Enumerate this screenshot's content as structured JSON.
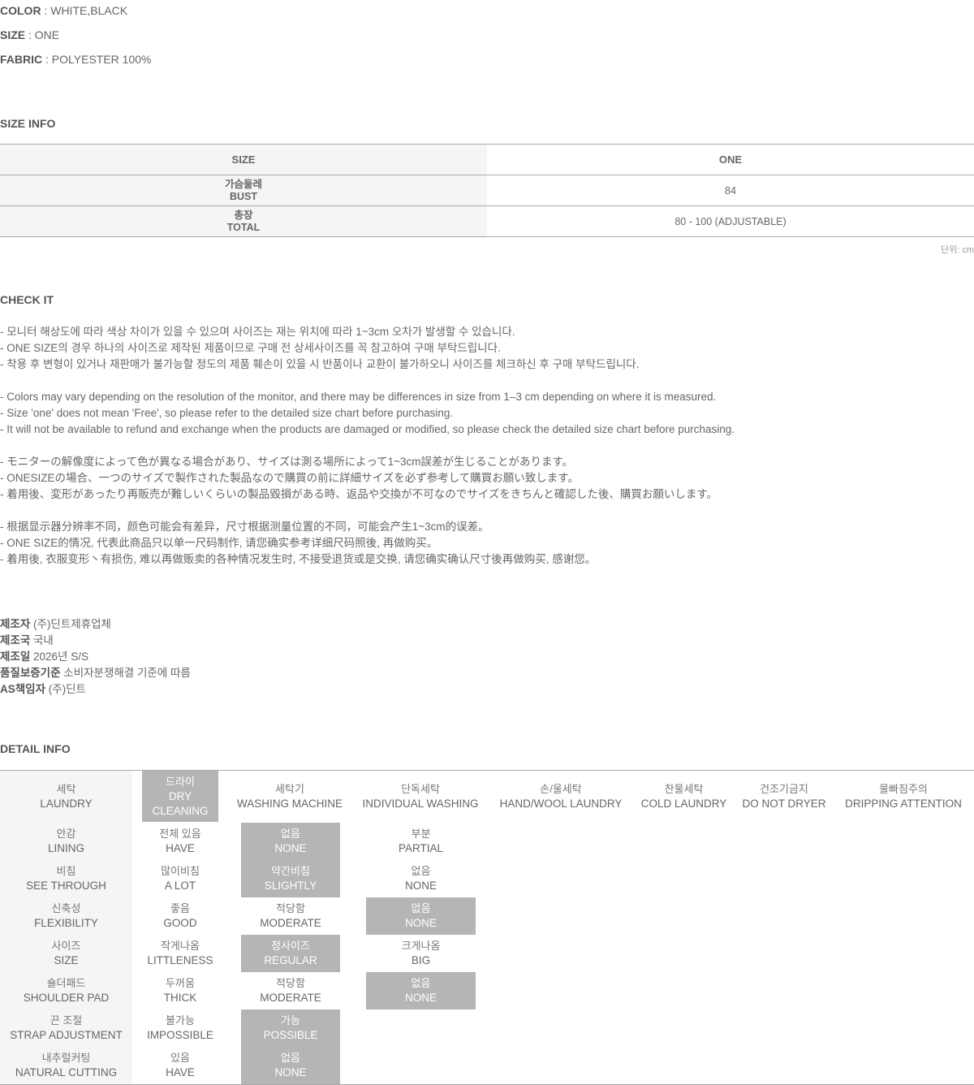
{
  "specs": [
    {
      "key": "COLOR",
      "value": " : WHITE,BLACK"
    },
    {
      "key": "SIZE",
      "value": " : ONE"
    },
    {
      "key": "FABRIC",
      "value": " : POLYESTER 100%"
    }
  ],
  "size_info": {
    "title": "SIZE INFO",
    "header": {
      "label": "SIZE",
      "value": "ONE"
    },
    "rows": [
      {
        "ko": "가슴둘레",
        "en": "BUST",
        "value": "84"
      },
      {
        "ko": "총장",
        "en": "TOTAL",
        "value": "80 - 100 (ADJUSTABLE)"
      }
    ],
    "unit": "단위: cm"
  },
  "check_it": {
    "title": "CHECK IT",
    "lines": [
      "- 모니터 해상도에 따라 색상 차이가 있을 수 있으며 사이즈는 재는 위치에 따라 1~3cm 오차가 발생할 수 있습니다.",
      "- ONE SIZE의 경우 하나의 사이즈로 제작된 제품이므로 구매 전 상세사이즈를 꼭 참고하여 구매 부탁드립니다.",
      "- 착용 후 변형이 있거나 재판매가 불가능할 정도의 제품 훼손이 있을 시 반품이나 교환이 불가하오니 사이즈를 체크하신 후 구매 부탁드립니다.",
      "- Colors may vary depending on the resolution of the monitor, and there may be differences in size from 1–3 cm depending on where it is measured.",
      "- Size 'one' does not mean 'Free', so please refer to the detailed size chart before purchasing.",
      "- It will not be available to refund and exchange when the products are damaged or modified, so please check the detailed size chart before purchasing.",
      "- モニターの解像度によって色が異なる場合があり、サイズは測る場所によって1~3cm誤差が生じることがあります。",
      "- ONESIZEの場合、一つのサイズで製作された製品なので購買の前に詳細サイズを必ず参考して購買お願い致します。",
      "- 着用後、変形があったり再販売が難しいくらいの製品毀損がある時、返品や交換が不可なのでサイズをきちんと確認した後、購買お願いします。",
      "- 根据显示器分辨率不同，颜色可能会有差异，尺寸根据测量位置的不同，可能会产生1~3cm的误差。",
      "- ONE SIZE的情况, 代表此商品只以单一尺码制作, 请您确实参考详细尺码照後, 再做购买。",
      "- 着用後, 衣服变形丶有损伤, 难以再做贩卖的各种情况发生时, 不接受退货或是交换, 请您确实确认尺寸後再做购买, 感谢您。"
    ]
  },
  "manufacturer": [
    {
      "key": "제조자",
      "value": " (주)딘트제휴업체"
    },
    {
      "key": "제조국",
      "value": " 국내"
    },
    {
      "key": "제조일",
      "value": " 2026년 S/S"
    },
    {
      "key": "품질보증기준",
      "value": " 소비자분쟁해결 기준에 따름"
    },
    {
      "key": "AS책임자",
      "value": " (주)딘트"
    }
  ],
  "detail_info": {
    "title": "DETAIL INFO",
    "laundry": {
      "label": {
        "ko": "세탁",
        "en": "LAUNDRY"
      },
      "options": [
        {
          "ko": "드라이",
          "en": "DRY CLEANING",
          "selected": true
        },
        {
          "ko": "세탁기",
          "en": "WASHING MACHINE",
          "selected": false
        },
        {
          "ko": "단독세탁",
          "en": "INDIVIDUAL WASHING",
          "selected": false
        },
        {
          "ko": "손/울세탁",
          "en": "HAND/WOOL LAUNDRY",
          "selected": false
        },
        {
          "ko": "찬물세탁",
          "en": "COLD LAUNDRY",
          "selected": false
        },
        {
          "ko": "건조기금지",
          "en": "DO NOT DRYER",
          "selected": false
        },
        {
          "ko": "물빠짐주의",
          "en": "DRIPPING ATTENTION",
          "selected": false
        }
      ]
    },
    "rows": [
      {
        "label": {
          "ko": "안감",
          "en": "LINING"
        },
        "options": [
          {
            "ko": "전체 있음",
            "en": "HAVE",
            "selected": false
          },
          {
            "ko": "없음",
            "en": "NONE",
            "selected": true
          },
          {
            "ko": "부분",
            "en": "PARTIAL",
            "selected": false
          }
        ]
      },
      {
        "label": {
          "ko": "비침",
          "en": "SEE THROUGH"
        },
        "options": [
          {
            "ko": "많이비침",
            "en": "A LOT",
            "selected": false
          },
          {
            "ko": "약간비침",
            "en": "SLIGHTLY",
            "selected": true
          },
          {
            "ko": "없음",
            "en": "NONE",
            "selected": false
          }
        ]
      },
      {
        "label": {
          "ko": "신축성",
          "en": "FLEXIBILITY"
        },
        "options": [
          {
            "ko": "좋음",
            "en": "GOOD",
            "selected": false
          },
          {
            "ko": "적당함",
            "en": "MODERATE",
            "selected": false
          },
          {
            "ko": "없음",
            "en": "NONE",
            "selected": true
          }
        ]
      },
      {
        "label": {
          "ko": "사이즈",
          "en": "SIZE"
        },
        "options": [
          {
            "ko": "작게나옴",
            "en": "LITTLENESS",
            "selected": false
          },
          {
            "ko": "정사이즈",
            "en": "REGULAR",
            "selected": true
          },
          {
            "ko": "크게나옴",
            "en": "BIG",
            "selected": false
          }
        ]
      },
      {
        "label": {
          "ko": "숄더패드",
          "en": "SHOULDER PAD"
        },
        "options": [
          {
            "ko": "두꺼움",
            "en": "THICK",
            "selected": false
          },
          {
            "ko": "적당함",
            "en": "MODERATE",
            "selected": false
          },
          {
            "ko": "없음",
            "en": "NONE",
            "selected": true
          }
        ]
      },
      {
        "label": {
          "ko": "끈 조절",
          "en": "STRAP ADJUSTMENT"
        },
        "options": [
          {
            "ko": "불가능",
            "en": "IMPOSSIBLE",
            "selected": false
          },
          {
            "ko": "가능",
            "en": "POSSIBLE",
            "selected": true
          }
        ]
      },
      {
        "label": {
          "ko": "내추럴커팅",
          "en": "NATURAL CUTTING"
        },
        "options": [
          {
            "ko": "있음",
            "en": "HAVE",
            "selected": false
          },
          {
            "ko": "없음",
            "en": "NONE",
            "selected": true
          }
        ]
      }
    ]
  }
}
